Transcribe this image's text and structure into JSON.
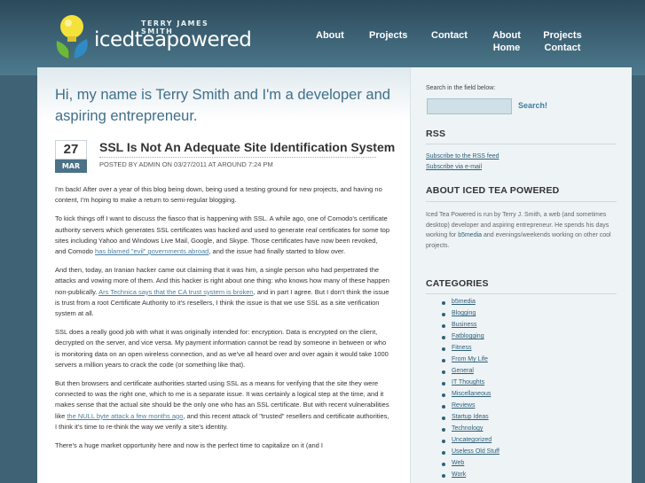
{
  "header": {
    "logo_top": "TERRY JAMES SMITH",
    "logo_name": "icedteapowered",
    "nav": [
      {
        "label": "About"
      },
      {
        "label": "Projects"
      },
      {
        "label": "Contact"
      },
      {
        "label": "About Home"
      },
      {
        "label": "Projects Contact"
      }
    ]
  },
  "intro": "Hi, my name is Terry Smith and I'm a developer and aspiring entrepreneur.",
  "post": {
    "day": "27",
    "month": "MAR",
    "title": "SSL Is Not An Adequate Site Identification System",
    "meta": "POSTED BY ADMIN ON 03/27/2011 AT AROUND 7:24 PM",
    "p1": "I'm back!  After over a year of this blog being down, being used a testing ground for new projects, and having no content, I'm hoping to make a return to semi-regular blogging.",
    "p2_a": "To kick things off I want to discuss the fiasco that is happening with SSL.  A while ago, one of Comodo's certificate authority servers which generates SSL certificates was hacked and used to generate ",
    "p2_em": "real",
    "p2_b": " certificates for some top sites including Yahoo and Windows Live Mail, Google, and Skype.  Those certificates have now been revoked, and Comodo ",
    "p2_link": "has blamed \"evil\" governments abroad",
    "p2_c": ", and the issue had finally started to blow over.",
    "p3_a": "And then, today, an Iranian hacker came out claiming that it was him, a single person who had perpetrated the attacks and vowing more of them.  And this hacker is right about one thing: who knows how many of these happen non-publically.  ",
    "p3_link": "Ars Technica says that the CA trust system is broken",
    "p3_b": ", and in part I agree.  But I don't think the issue is trust from a root Certificate Authority to it's resellers, I think the issue is that we use SSL as a site verification system at all.",
    "p4": "SSL does a really good job with what it was originally intended for: encryption.  Data is encrypted on the client, decrypted on the server, and vice versa.  My payment information cannot be read by someone in between or who is monitoring data on an open wireless connection, and as we've all heard over and over again it would take 1000 servers a million years to crack the code (or something like that).",
    "p5_a": "But then browsers and certificate authorities started using SSL as a means for verifying that the site they were connected to was the right one, which to me is a separate issue.  It was certainly a logical step at the time, and it makes sense that the actual site should be the only one who has an SSL certificate.  But with recent vulnerabilities like ",
    "p5_link": "the NULL byte attack a few months ago",
    "p5_b": ", and this recent attack of \"trusted\" resellers and certificate authorities, I think it's time to re-think the way we verify a site's identity.",
    "p6": "There's a huge market opportunity here and now is the perfect time to capitalize on it (and I"
  },
  "sidebar": {
    "search_label": "Search in the field below:",
    "search_button": "Search!",
    "rss_heading": "RSS",
    "rss_link1": "Subscribe to the RSS feed",
    "rss_link2": "Subscribe via e-mail",
    "about_heading": "ABOUT ICED TEA POWERED",
    "about_text_a": "Iced Tea Powered is run by Terry J. Smith, a web (and sometimes desktop) developer and aspiring entrepreneur. He spends his days working for ",
    "about_link": "b5media",
    "about_text_b": " and evenings/weekends working on other cool projects.",
    "categories_heading": "CATEGORIES",
    "categories": [
      "b5media",
      "Blogging",
      "Business",
      "Fatblogging",
      "Fitness",
      "From My Life",
      "General",
      "IT Thoughts",
      "Miscellaneous",
      "Reviews",
      "Startup Ideas",
      "Technology",
      "Uncategorized",
      "Useless Old Stuff",
      "Web",
      "Work"
    ]
  },
  "colors": {
    "header": "#3d6275",
    "accent": "#4b7287",
    "link": "#2d5f7a"
  }
}
